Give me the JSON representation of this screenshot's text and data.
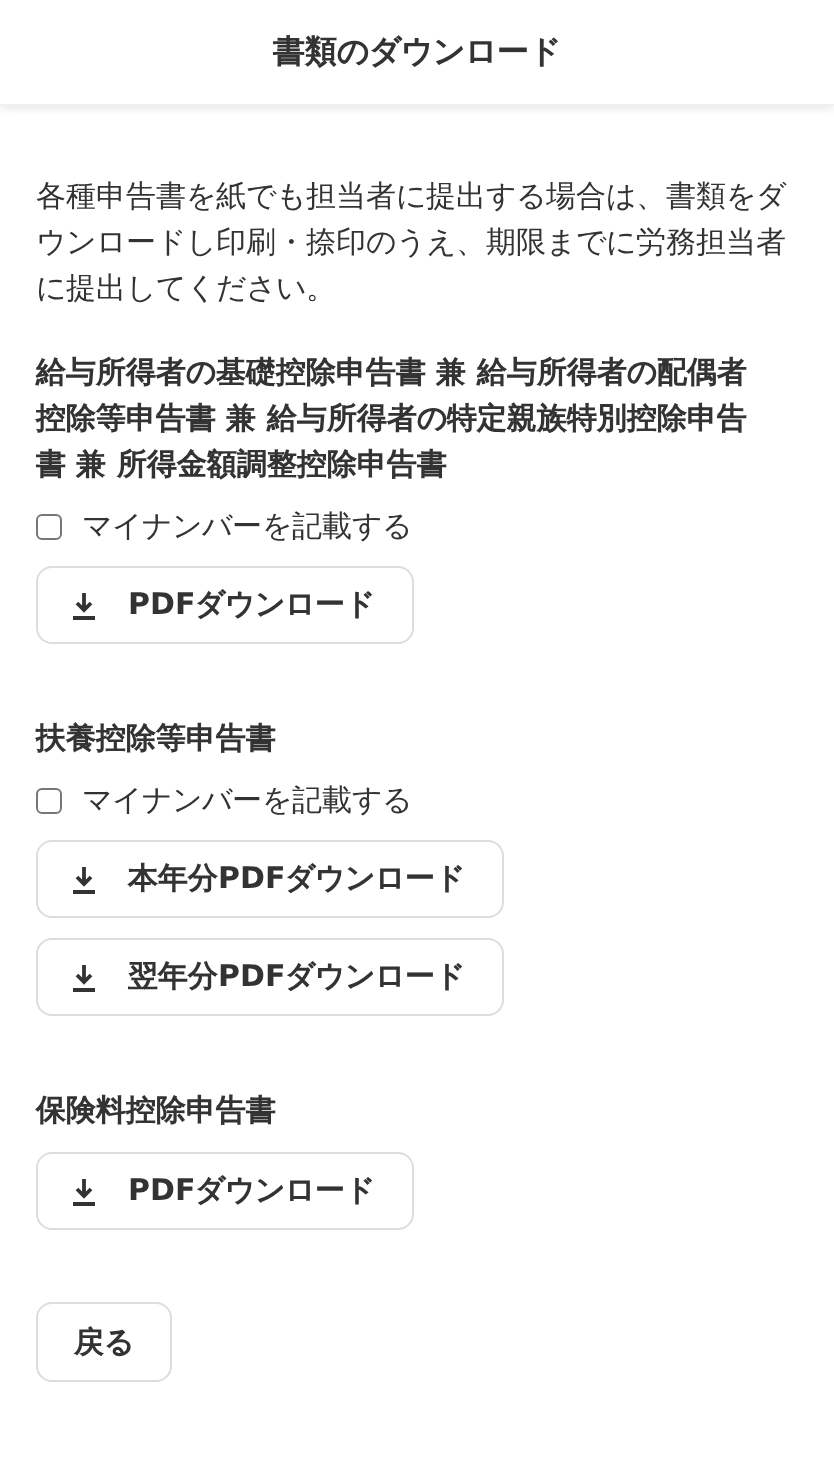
{
  "header": {
    "title": "書類のダウンロード"
  },
  "intro": "各種申告書を紙でも担当者に提出する場合は、書類をダウンロードし印刷・捺印のうえ、期限までに労務担当者に提出してください。",
  "sections": [
    {
      "title": "給与所得者の基礎控除申告書 兼 給与所得者の配偶者控除等申告書 兼 給与所得者の特定親族特別控除申告書 兼 所得金額調整控除申告書",
      "checkbox": {
        "label": "マイナンバーを記載する",
        "checked": false
      },
      "buttons": [
        "PDFダウンロード"
      ]
    },
    {
      "title": "扶養控除等申告書",
      "checkbox": {
        "label": "マイナンバーを記載する",
        "checked": false
      },
      "buttons": [
        "本年分PDFダウンロード",
        "翌年分PDFダウンロード"
      ]
    },
    {
      "title": "保険料控除申告書",
      "buttons": [
        "PDFダウンロード"
      ]
    }
  ],
  "back_button": "戻る"
}
